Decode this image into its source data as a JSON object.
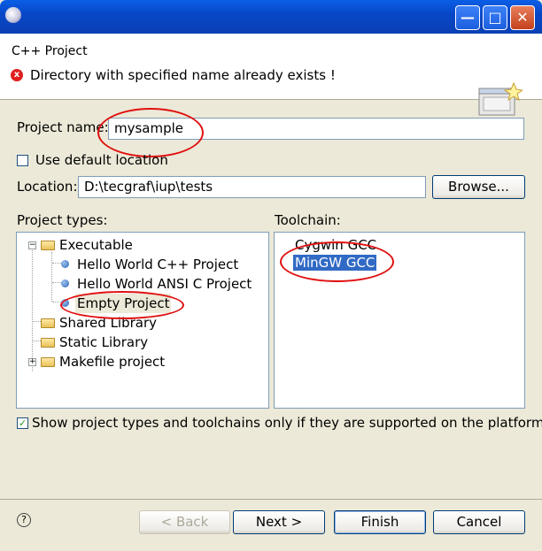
{
  "titlebar": {
    "title": ""
  },
  "header": {
    "title": "C++ Project",
    "message": "Directory with specified name already exists !"
  },
  "form": {
    "project_name_label": "Project name:",
    "project_name_value": "mysample",
    "use_default_location_label": "Use default location",
    "use_default_location_checked": false,
    "location_label": "Location:",
    "location_value": "D:\\tecgraf\\iup\\tests",
    "browse_label": "Browse..."
  },
  "project_types": {
    "label": "Project types:",
    "items": [
      {
        "label": "Executable",
        "kind": "folder",
        "expanded": true
      },
      {
        "label": "Hello World C++ Project",
        "kind": "leaf"
      },
      {
        "label": "Hello World ANSI C Project",
        "kind": "leaf"
      },
      {
        "label": "Empty Project",
        "kind": "leaf",
        "selected": true
      },
      {
        "label": "Shared Library",
        "kind": "folder"
      },
      {
        "label": "Static Library",
        "kind": "folder"
      },
      {
        "label": "Makefile project",
        "kind": "folder",
        "expanded": false
      }
    ]
  },
  "toolchain": {
    "label": "Toolchain:",
    "items": [
      {
        "label": "Cygwin GCC"
      },
      {
        "label": "MinGW GCC",
        "selected": true
      }
    ]
  },
  "filter": {
    "label": "Show project types and toolchains only if they are supported on the platform",
    "checked": true
  },
  "buttons": {
    "back": "< Back",
    "next": "Next >",
    "finish": "Finish",
    "cancel": "Cancel"
  },
  "colors": {
    "selection": "#316ac5",
    "annotation": "#e01010",
    "titlebar": "#0a5fe6"
  }
}
